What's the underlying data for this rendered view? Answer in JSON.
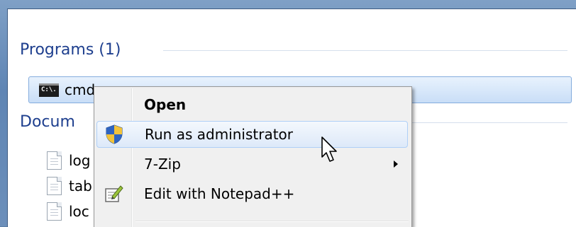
{
  "programs": {
    "header": "Programs (1)",
    "items": [
      {
        "label": "cmd",
        "icon": "cmd-icon",
        "icon_text": "C:\\."
      }
    ]
  },
  "documents": {
    "header": "Docum",
    "items": [
      {
        "label": "log",
        "icon": "text-file-icon"
      },
      {
        "label": "tab",
        "icon": "text-file-icon"
      },
      {
        "label": "loc",
        "icon": "text-file-icon"
      }
    ]
  },
  "context_menu": {
    "items": [
      {
        "label": "Open",
        "bold": true,
        "icon": ""
      },
      {
        "label": "Run as administrator",
        "icon": "uac-shield-icon",
        "highlighted": true
      },
      {
        "label": "7-Zip",
        "icon": "",
        "submenu": true
      },
      {
        "label": "Edit with Notepad++",
        "icon": "notepad-plus-plus-icon"
      }
    ]
  },
  "colors": {
    "header_text": "#1e3f8e",
    "selection_border": "#84acdd",
    "menu_background": "#f0f0f0",
    "frame": "#5f85b4"
  }
}
